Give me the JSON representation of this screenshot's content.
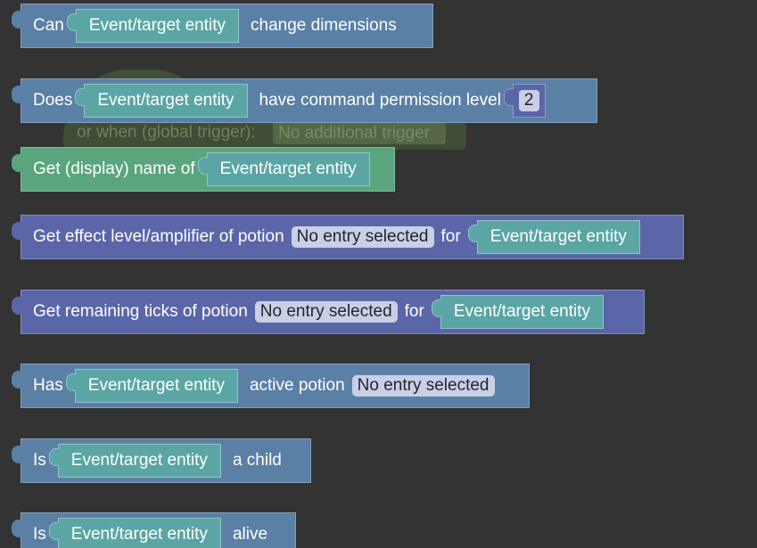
{
  "ghost": {
    "label": "or when (global trigger):",
    "dropdown": "No additional trigger"
  },
  "blocks": [
    {
      "pre": "Can",
      "slot": "Event/target entity",
      "post": "change dimensions"
    },
    {
      "pre": "Does",
      "slot": "Event/target entity",
      "post": "have command permission level",
      "num": "2"
    },
    {
      "pre": "Get (display) name of",
      "slot": "Event/target entity"
    },
    {
      "pre": "Get effect level/amplifier of potion",
      "dropdown": "No entry selected",
      "mid": "for",
      "slot": "Event/target entity"
    },
    {
      "pre": "Get remaining ticks of potion",
      "dropdown": "No entry selected",
      "mid": "for",
      "slot": "Event/target entity"
    },
    {
      "pre": "Has",
      "slot": "Event/target entity",
      "post": "active potion",
      "dropdown": "No entry selected"
    },
    {
      "pre": "Is",
      "slot": "Event/target entity",
      "post": "a child"
    },
    {
      "pre": "Is",
      "slot": "Event/target entity",
      "post": "alive"
    }
  ],
  "colors": {
    "background": "#333333",
    "blue_block": "#5a80a6",
    "purple_block": "#5b66a8",
    "green_block": "#5aa57e",
    "entity_slot": "#5ba5a5",
    "dropdown": "#c9cfe6"
  }
}
